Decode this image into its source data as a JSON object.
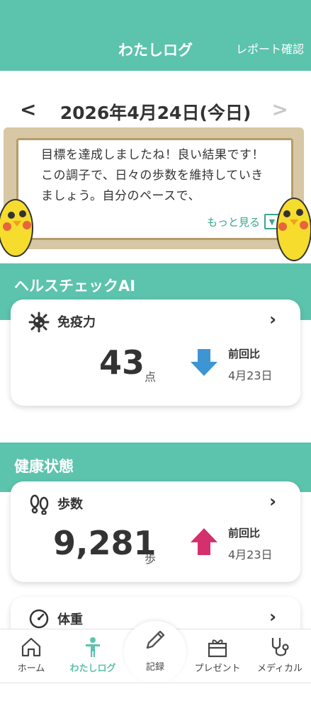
{
  "header": {
    "title": "わたしログ",
    "report_label": "レポート確認"
  },
  "datebar": {
    "prev_label": "<",
    "next_label": ">",
    "date": "2026年4月24日(今日)"
  },
  "message": {
    "text": "目標を達成しましたね！良い結果です！この調子で、日々の歩数を維持していきましょう。自分のペースで、",
    "more_label": "もっと見る"
  },
  "health_check": {
    "title": "ヘルスチェックAI",
    "card": {
      "label": "免疫力",
      "value": "43",
      "unit": "点",
      "compare_label": "前回比",
      "compare_date": "4月23日",
      "trend": "down",
      "trend_color": "#3d95d4"
    }
  },
  "health_status": {
    "title": "健康状態",
    "steps": {
      "label": "歩数",
      "value": "9,281",
      "unit": "歩",
      "compare_label": "前回比",
      "compare_date": "4月23日",
      "trend": "up",
      "trend_color": "#d4306e"
    },
    "weight": {
      "label": "体重"
    }
  },
  "tabs": [
    {
      "label": "ホーム",
      "icon": "home-icon"
    },
    {
      "label": "わたしログ",
      "icon": "person-icon",
      "active": true
    },
    {
      "label": "記録",
      "icon": "pencil-icon"
    },
    {
      "label": "プレゼント",
      "icon": "gift-icon"
    },
    {
      "label": "メディカル",
      "icon": "stethoscope-icon"
    }
  ],
  "colors": {
    "accent": "#5cc3ad",
    "link": "#3aa58e"
  }
}
